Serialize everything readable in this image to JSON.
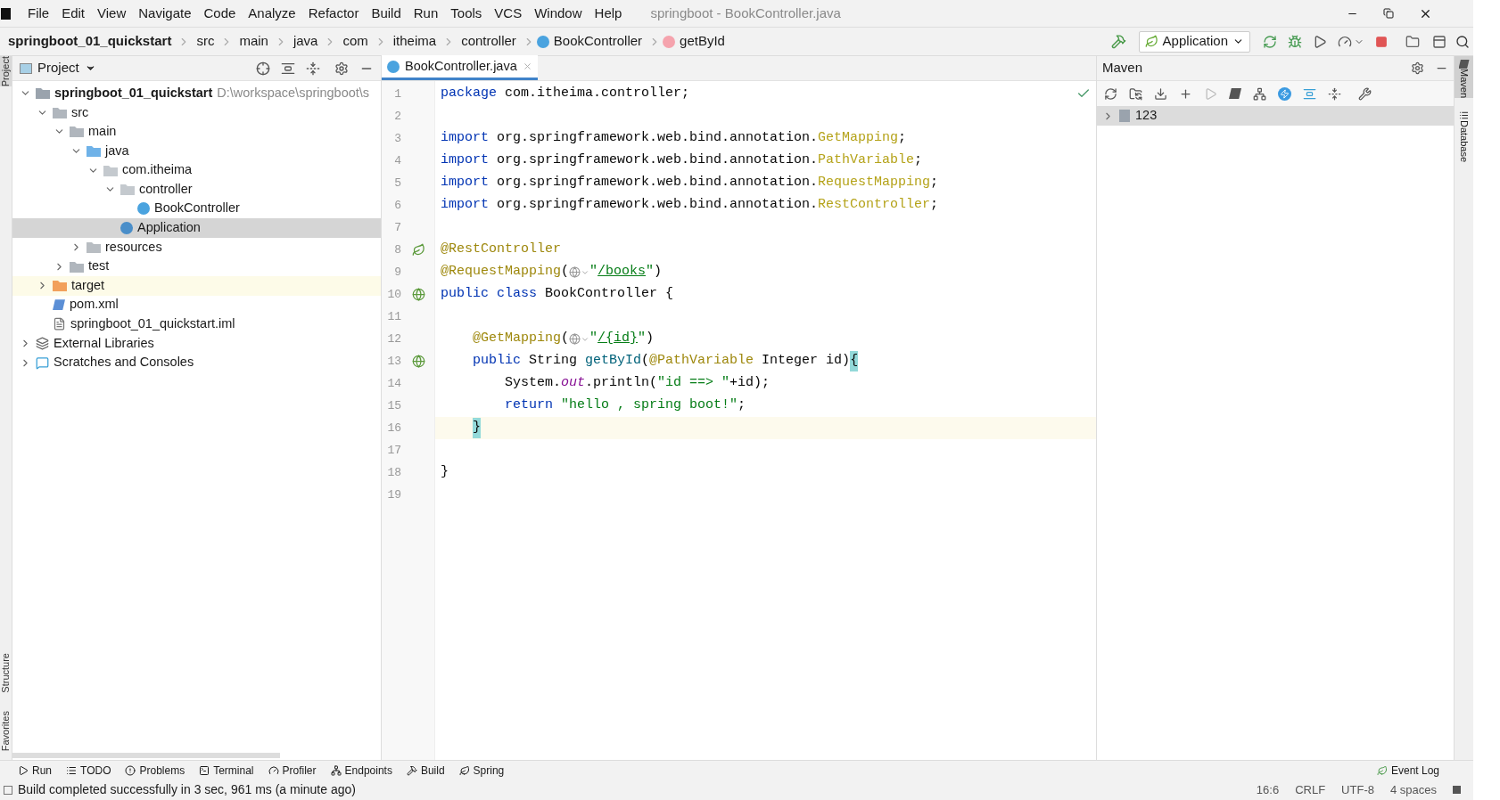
{
  "menu": [
    "File",
    "Edit",
    "View",
    "Navigate",
    "Code",
    "Analyze",
    "Refactor",
    "Build",
    "Run",
    "Tools",
    "VCS",
    "Window",
    "Help"
  ],
  "window": {
    "title": "springboot - BookController.java"
  },
  "breadcrumbs": [
    {
      "text": "springboot_01_quickstart",
      "kind": "root"
    },
    {
      "text": "src",
      "kind": "plain"
    },
    {
      "text": "main",
      "kind": "plain"
    },
    {
      "text": "java",
      "kind": "plain"
    },
    {
      "text": "com",
      "kind": "plain"
    },
    {
      "text": "itheima",
      "kind": "plain"
    },
    {
      "text": "controller",
      "kind": "plain"
    },
    {
      "text": "BookController",
      "kind": "class"
    },
    {
      "text": "getById",
      "kind": "method"
    }
  ],
  "run_config": "Application",
  "left_strip": [
    "Project",
    "Structure",
    "Favorites"
  ],
  "right_strip": [
    "Maven",
    "Database"
  ],
  "project": {
    "title": "Project",
    "tree": [
      {
        "label": "springboot_01_quickstart",
        "hint": "D:\\workspace\\springboot\\s",
        "kind": "module",
        "expanded": true,
        "selected": false,
        "children": [
          {
            "label": "src",
            "kind": "folder",
            "expanded": true,
            "selected": false,
            "children": [
              {
                "label": "main",
                "kind": "folder",
                "expanded": true,
                "selected": false,
                "children": [
                  {
                    "label": "java",
                    "kind": "source",
                    "expanded": true,
                    "selected": false,
                    "children": [
                      {
                        "label": "com.itheima",
                        "kind": "package",
                        "expanded": true,
                        "selected": false,
                        "children": [
                          {
                            "label": "controller",
                            "kind": "package",
                            "expanded": true,
                            "selected": false,
                            "children": [
                              {
                                "label": "BookController",
                                "kind": "class",
                                "selected": false
                              }
                            ]
                          },
                          {
                            "label": "Application",
                            "kind": "spring",
                            "selected": true
                          }
                        ]
                      }
                    ]
                  },
                  {
                    "label": "resources",
                    "kind": "resources",
                    "expanded": false,
                    "selected": false
                  }
                ]
              },
              {
                "label": "test",
                "kind": "folder",
                "expanded": false,
                "selected": false
              }
            ]
          },
          {
            "label": "target",
            "kind": "excluded",
            "expanded": false,
            "selected": false
          },
          {
            "label": "pom.xml",
            "kind": "maven",
            "selected": false
          },
          {
            "label": "springboot_01_quickstart.iml",
            "kind": "file",
            "selected": false
          }
        ]
      },
      {
        "label": "External Libraries",
        "kind": "libraries",
        "expanded": false,
        "selected": false
      },
      {
        "label": "Scratches and Consoles",
        "kind": "scratches",
        "expanded": false,
        "selected": false
      }
    ]
  },
  "tabs": [
    {
      "label": "BookController.java",
      "selected": true
    }
  ],
  "code": [
    {
      "number": "1",
      "kind": "top",
      "tokens": [
        {
          "text": "package",
          "kind": "kw"
        },
        {
          "text": " com.itheima.controller;",
          "kind": "plain"
        }
      ]
    },
    {
      "number": "2"
    },
    {
      "number": "3",
      "kind": "top",
      "tokens": [
        {
          "text": "import",
          "kind": "kw"
        },
        {
          "text": " org.springframework.web.bind.annotation.",
          "kind": "plain"
        },
        {
          "text": "GetMapping",
          "kind": "unused"
        },
        {
          "text": ";",
          "kind": "plain"
        }
      ]
    },
    {
      "number": "4",
      "kind": "top",
      "tokens": [
        {
          "text": "import",
          "kind": "kw"
        },
        {
          "text": " org.springframework.web.bind.annotation.",
          "kind": "plain"
        },
        {
          "text": "PathVariable",
          "kind": "unused"
        },
        {
          "text": ";",
          "kind": "plain"
        }
      ]
    },
    {
      "number": "5",
      "kind": "top",
      "tokens": [
        {
          "text": "import",
          "kind": "kw"
        },
        {
          "text": " org.springframework.web.bind.annotation.",
          "kind": "plain"
        },
        {
          "text": "RequestMapping",
          "kind": "unused"
        },
        {
          "text": ";",
          "kind": "plain"
        }
      ]
    },
    {
      "number": "6",
      "kind": "top",
      "tokens": [
        {
          "text": "import",
          "kind": "kw"
        },
        {
          "text": " org.springframework.web.bind.annotation.",
          "kind": "plain"
        },
        {
          "text": "RestController",
          "kind": "unused"
        },
        {
          "text": ";",
          "kind": "plain"
        }
      ]
    },
    {
      "number": "7"
    },
    {
      "number": "8",
      "kind": "top",
      "gutter": {
        "kind": "bean"
      },
      "tokens": [
        {
          "text": "@RestController",
          "kind": "annotation"
        }
      ]
    },
    {
      "number": "9",
      "kind": "top",
      "tokens": [
        {
          "text": "@RequestMapping",
          "kind": "annotation"
        },
        {
          "text": "(",
          "kind": "plain"
        },
        {
          "kind": "inlay"
        },
        {
          "text": "\"",
          "kind": "string"
        },
        {
          "text": "/books",
          "kind": "url"
        },
        {
          "text": "\"",
          "kind": "string"
        },
        {
          "text": ")",
          "kind": "plain"
        }
      ]
    },
    {
      "number": "10",
      "kind": "top",
      "gutter": {
        "kind": "endpoint"
      },
      "tokens": [
        {
          "text": "public class",
          "kind": "kw"
        },
        {
          "text": " BookController {",
          "kind": "plain"
        }
      ]
    },
    {
      "number": "11"
    },
    {
      "number": "12",
      "kind": "member",
      "tokens": [
        {
          "text": "@GetMapping",
          "kind": "annotation"
        },
        {
          "text": "(",
          "kind": "plain"
        },
        {
          "kind": "inlay"
        },
        {
          "text": "\"",
          "kind": "string"
        },
        {
          "text": "/{id}",
          "kind": "url"
        },
        {
          "text": "\"",
          "kind": "string"
        },
        {
          "text": ")",
          "kind": "plain"
        }
      ]
    },
    {
      "number": "13",
      "kind": "member",
      "gutter": {
        "kind": "endpoint"
      },
      "tokens": [
        {
          "text": "public",
          "kind": "kw"
        },
        {
          "text": " String ",
          "kind": "plain"
        },
        {
          "text": "getById",
          "kind": "method"
        },
        {
          "text": "(",
          "kind": "plain"
        },
        {
          "text": "@PathVariable",
          "kind": "annotation"
        },
        {
          "text": " Integer id)",
          "kind": "plain"
        },
        {
          "text": "{",
          "kind": "brace"
        }
      ]
    },
    {
      "number": "14",
      "kind": "body",
      "tokens": [
        {
          "text": "System.",
          "kind": "plain"
        },
        {
          "text": "out",
          "kind": "field"
        },
        {
          "text": ".println(",
          "kind": "plain"
        },
        {
          "text": "\"id ==> \"",
          "kind": "string"
        },
        {
          "text": "+id);",
          "kind": "plain"
        }
      ]
    },
    {
      "number": "15",
      "kind": "body",
      "tokens": [
        {
          "text": "return",
          "kind": "kw"
        },
        {
          "text": " \"hello , spring boot!\"",
          "kind": "string"
        },
        {
          "text": ";",
          "kind": "plain"
        }
      ]
    },
    {
      "number": "16",
      "kind": "member",
      "current": true,
      "tokens": [
        {
          "text": "}",
          "kind": "brace"
        }
      ]
    },
    {
      "number": "17"
    },
    {
      "number": "18",
      "kind": "top",
      "tokens": [
        {
          "text": "}",
          "kind": "plain"
        }
      ]
    },
    {
      "number": "19"
    }
  ],
  "maven": {
    "title": "Maven",
    "items": [
      {
        "label": "123",
        "expanded": false
      }
    ]
  },
  "tool_buttons": [
    {
      "label": "Run",
      "kind": "run"
    },
    {
      "label": "TODO",
      "kind": "todo"
    },
    {
      "label": "Problems",
      "kind": "problems"
    },
    {
      "label": "Terminal",
      "kind": "terminal"
    },
    {
      "label": "Profiler",
      "kind": "profiler"
    },
    {
      "label": "Endpoints",
      "kind": "endpoints"
    },
    {
      "label": "Build",
      "kind": "build"
    },
    {
      "label": "Spring",
      "kind": "spring"
    }
  ],
  "event_log": "Event Log",
  "status": {
    "message": "Build completed successfully in 3 sec, 961 ms (a minute ago)",
    "position": "16:6",
    "line_separator": "CRLF",
    "encoding": "UTF-8",
    "indent": "4 spaces"
  }
}
